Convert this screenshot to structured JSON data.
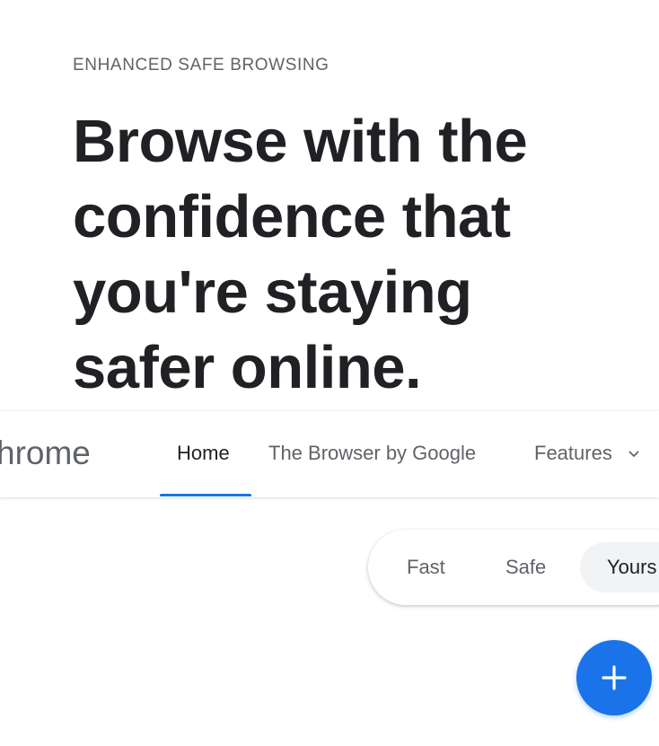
{
  "hero": {
    "eyebrow": "ENHANCED SAFE BROWSING",
    "headline_lines": [
      "Browse with the",
      "confidence that",
      "you're staying",
      "safer online."
    ]
  },
  "navbar": {
    "brand_partial": "hrome",
    "items": [
      {
        "label": "Home",
        "active": true
      },
      {
        "label": "The Browser by Google",
        "active": false
      },
      {
        "label": "Features",
        "active": false,
        "icon": "chevron-down-icon"
      }
    ]
  },
  "segmented_control": {
    "options": [
      {
        "label": "Fast",
        "selected": false
      },
      {
        "label": "Safe",
        "selected": false
      },
      {
        "label": "Yours",
        "selected": true
      }
    ]
  },
  "fab": {
    "icon": "plus-icon"
  },
  "colors": {
    "accent": "#1a73e8",
    "text_primary": "#202124",
    "text_secondary": "#5f6368",
    "pill_selected_bg": "#f1f3f4"
  }
}
